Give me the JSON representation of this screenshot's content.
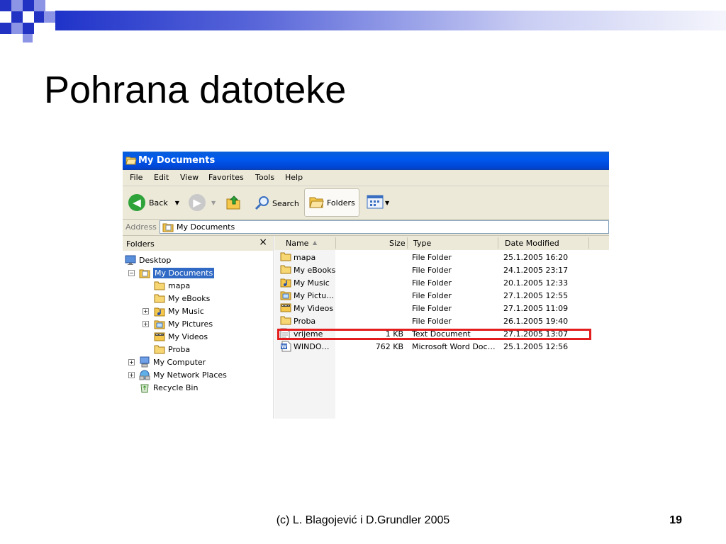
{
  "slide": {
    "title": "Pohrana datoteke",
    "footer": "(c) L. Blagojević i D.Grundler 2005",
    "page_number": "19"
  },
  "window": {
    "title": "My Documents",
    "menu": [
      "File",
      "Edit",
      "View",
      "Favorites",
      "Tools",
      "Help"
    ],
    "toolbar": {
      "back_label": "Back",
      "search_label": "Search",
      "folders_label": "Folders"
    },
    "address": {
      "label": "Address",
      "value": "My Documents"
    },
    "folders_panel": {
      "title": "Folders",
      "close_glyph": "×",
      "items": [
        {
          "label": "Desktop",
          "icon": "desktop-icon"
        },
        {
          "label": "My Documents",
          "icon": "my-documents-icon",
          "selected": true
        },
        {
          "label": "mapa",
          "icon": "folder-icon"
        },
        {
          "label": "My eBooks",
          "icon": "folder-icon"
        },
        {
          "label": "My Music",
          "icon": "music-folder-icon"
        },
        {
          "label": "My Pictures",
          "icon": "pictures-folder-icon"
        },
        {
          "label": "My Videos",
          "icon": "videos-folder-icon"
        },
        {
          "label": "Proba",
          "icon": "folder-icon"
        },
        {
          "label": "My Computer",
          "icon": "computer-icon"
        },
        {
          "label": "My Network Places",
          "icon": "network-icon"
        },
        {
          "label": "Recycle Bin",
          "icon": "recycle-bin-icon"
        }
      ]
    },
    "columns": [
      "Name",
      "Size",
      "Type",
      "Date Modified"
    ],
    "files": [
      {
        "name": "mapa",
        "size": "",
        "type": "File Folder",
        "date": "25.1.2005 16:20",
        "icon": "folder-icon"
      },
      {
        "name": "My eBooks",
        "size": "",
        "type": "File Folder",
        "date": "24.1.2005 23:17",
        "icon": "folder-icon"
      },
      {
        "name": "My Music",
        "size": "",
        "type": "File Folder",
        "date": "20.1.2005 12:33",
        "icon": "music-folder-icon"
      },
      {
        "name": "My Pictu…",
        "size": "",
        "type": "File Folder",
        "date": "27.1.2005 12:55",
        "icon": "pictures-folder-icon"
      },
      {
        "name": "My Videos",
        "size": "",
        "type": "File Folder",
        "date": "27.1.2005 11:09",
        "icon": "videos-folder-icon"
      },
      {
        "name": "Proba",
        "size": "",
        "type": "File Folder",
        "date": "26.1.2005 19:40",
        "icon": "folder-icon"
      },
      {
        "name": "vrijeme",
        "size": "1 KB",
        "type": "Text Document",
        "date": "27.1.2005 13:07",
        "icon": "text-document-icon",
        "highlighted": true
      },
      {
        "name": "WINDO…",
        "size": "762 KB",
        "type": "Microsoft Word Doc…",
        "date": "25.1.2005 12:56",
        "icon": "word-document-icon"
      }
    ]
  },
  "colors": {
    "title_bar": "#0058ee",
    "highlight_border": "#e31d1d",
    "selection": "#316ac5",
    "chrome": "#ece9d8"
  }
}
